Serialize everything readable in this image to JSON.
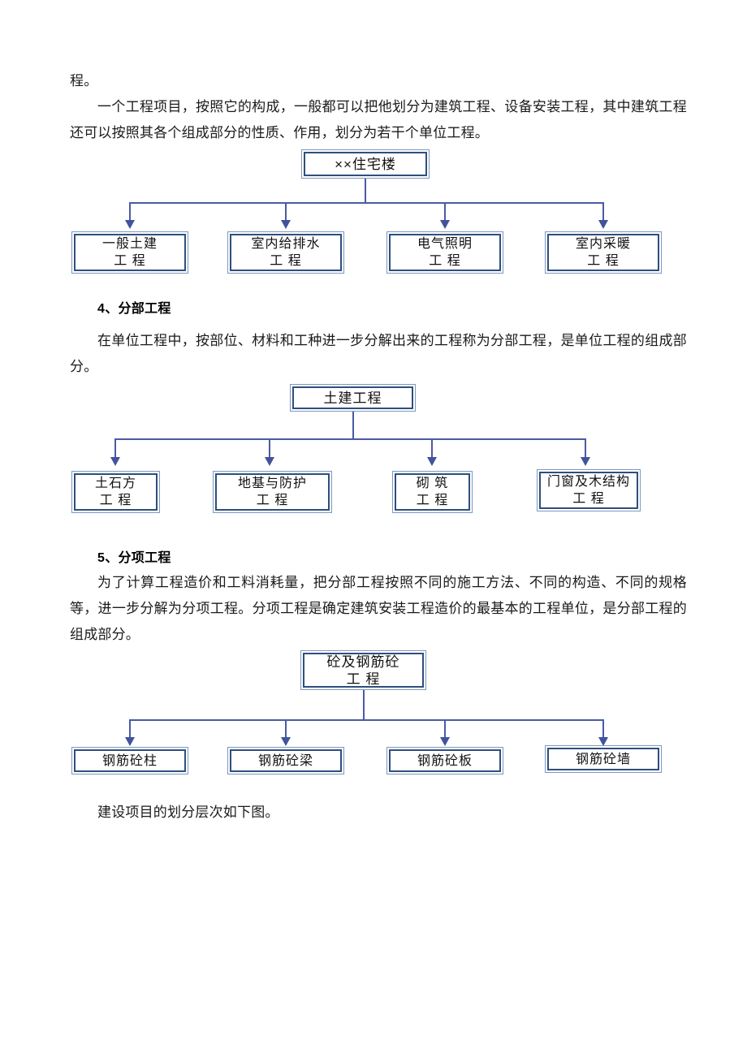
{
  "document": {
    "paragraphs": [
      {
        "id": "p_intro_tail",
        "text": "程。"
      },
      {
        "id": "p_intro",
        "text": "一个工程项目，按照它的构成，一般都可以把他划分为建筑工程、设备安装工程，其中建筑工程还可以按照其各个组成部分的性质、作用，划分为若干个单位工程。"
      },
      {
        "id": "p_fenbu_body",
        "text": "在单位工程中，按部位、材料和工种进一步分解出来的工程称为分部工程，是单位工程的组成部分。"
      },
      {
        "id": "p_fenxiang_body",
        "text": "为了计算工程造价和工料消耗量，把分部工程按照不同的施工方法、不同的构造、不同的规格等，进一步分解为分项工程。分项工程是确定建筑安装工程造价的最基本的工程单位，是分部工程的组成部分。"
      },
      {
        "id": "p_closing",
        "text": "建设项目的划分层次如下图。"
      }
    ],
    "headings": [
      {
        "id": "h_fenbu",
        "text": "4、分部工程"
      },
      {
        "id": "h_fenxiang",
        "text": "5、分项工程"
      }
    ]
  },
  "diagrams": [
    {
      "id": "diagram_unit_works",
      "root": {
        "label": "××住宅楼"
      },
      "children": [
        {
          "label": "一般土建\n工  程"
        },
        {
          "label": "室内给排水\n工  程"
        },
        {
          "label": "电气照明\n工  程"
        },
        {
          "label": "室内采暖\n工  程"
        }
      ]
    },
    {
      "id": "diagram_division_works",
      "root": {
        "label": "土建工程"
      },
      "children": [
        {
          "label": "土石方\n工  程"
        },
        {
          "label": "地基与防护\n工  程"
        },
        {
          "label": "砌  筑\n工  程"
        },
        {
          "label": "门窗及木结构\n工  程"
        }
      ]
    },
    {
      "id": "diagram_item_works",
      "root": {
        "label": "砼及钢筋砼\n工  程"
      },
      "children": [
        {
          "label": "钢筋砼柱"
        },
        {
          "label": "钢筋砼梁"
        },
        {
          "label": "钢筋砼板"
        },
        {
          "label": "钢筋砼墙"
        }
      ]
    }
  ],
  "colors": {
    "box_outer_border": "#7d97bd",
    "box_inner_border": "#2e4f7e",
    "connector": "#4a5ba3",
    "text": "#1a1a1a",
    "page_background": "#ffffff"
  }
}
